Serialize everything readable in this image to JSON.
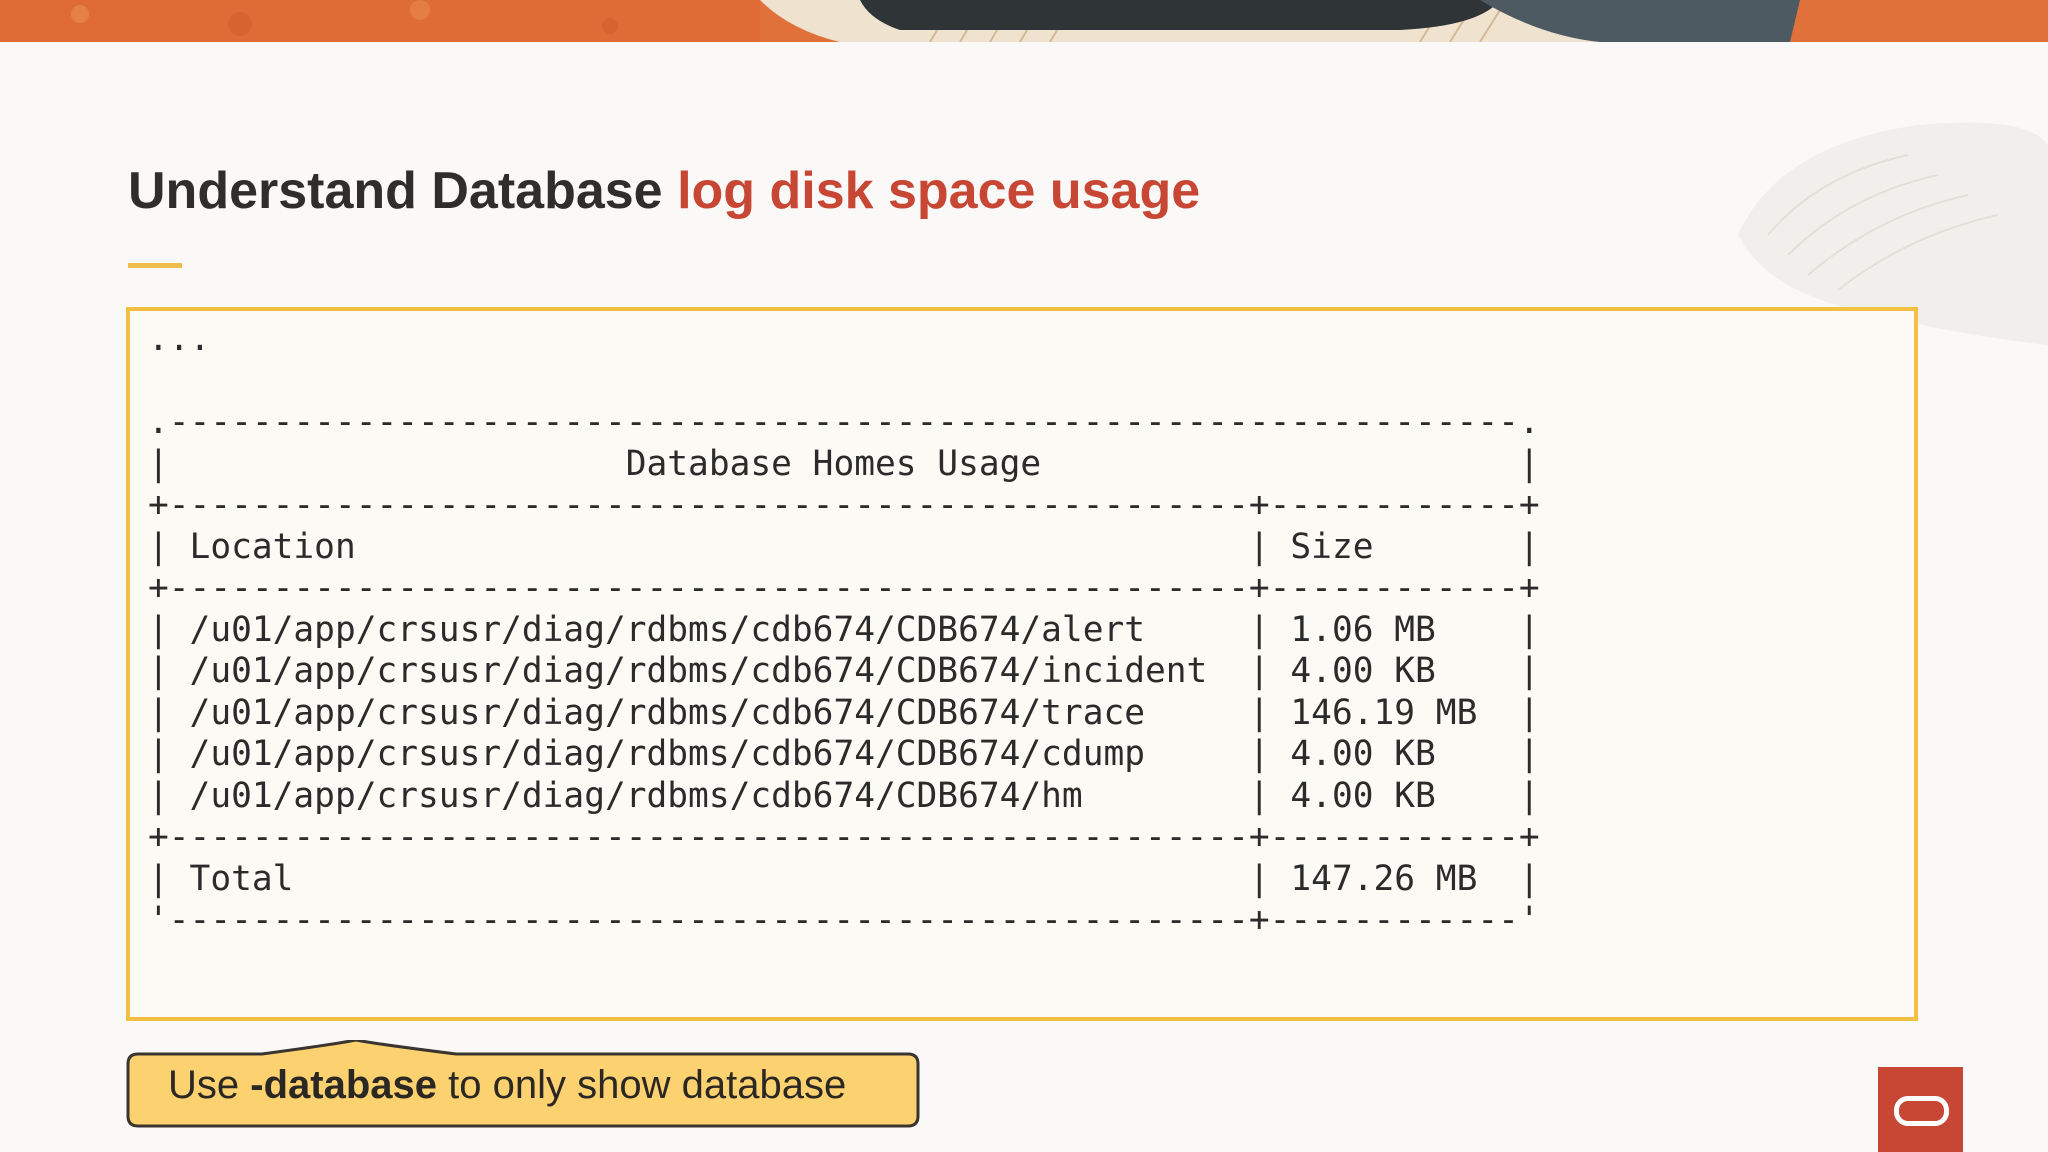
{
  "slide": {
    "title_part1": "Understand Database",
    "title_part2": "log disk space usage"
  },
  "code": {
    "ellipsis": "...",
    "table_title": "Database Homes Usage",
    "columns": [
      "Location",
      "Size"
    ],
    "rows": [
      {
        "location": "/u01/app/crsusr/diag/rdbms/cdb674/CDB674/alert",
        "size": "1.06 MB"
      },
      {
        "location": "/u01/app/crsusr/diag/rdbms/cdb674/CDB674/incident",
        "size": "4.00 KB"
      },
      {
        "location": "/u01/app/crsusr/diag/rdbms/cdb674/CDB674/trace",
        "size": "146.19 MB"
      },
      {
        "location": "/u01/app/crsusr/diag/rdbms/cdb674/CDB674/cdump",
        "size": "4.00 KB"
      },
      {
        "location": "/u01/app/crsusr/diag/rdbms/cdb674/CDB674/hm",
        "size": "4.00 KB"
      }
    ],
    "total": {
      "label": "Total",
      "size": "147.26 MB"
    }
  },
  "callout": {
    "prefix": "Use",
    "flag": "-database",
    "suffix": "to only show database"
  },
  "colors": {
    "accent": "#c74634",
    "highlight": "#f3c043",
    "callout_fill": "#fcd270",
    "text": "#312d2a"
  },
  "icons": {
    "logo": "oracle-logo-icon"
  }
}
